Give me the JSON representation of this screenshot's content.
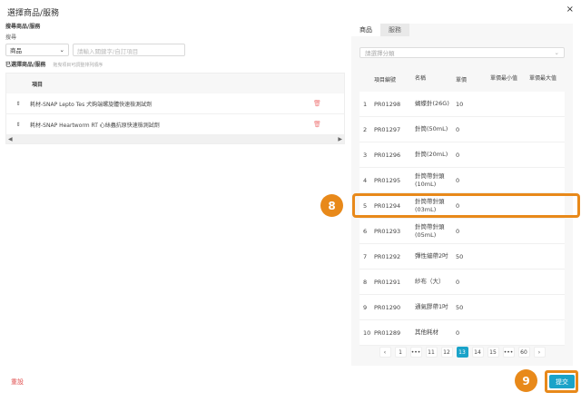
{
  "modal": {
    "title": "選擇商品/服務",
    "close": "×"
  },
  "left": {
    "search_label": "搜尋商品/服務",
    "search_sub": "搜尋",
    "type_select": "商品",
    "search_placeholder": "請輸入關鍵字/自訂項目",
    "selected_label": "已選擇商品/服務",
    "selected_hint": "拖曳項目可調整排列順序",
    "table_header": "項目",
    "items": [
      {
        "handle": "⇕",
        "name": "耗材-SNAP Lepto Tes 犬鉤端螺旋體快速檢測試劑",
        "trash": "🗑"
      },
      {
        "handle": "⇕",
        "name": "耗材-SNAP Heartworm RT 心絲蟲抗原快速檢測試劑",
        "trash": "🗑"
      }
    ],
    "scroll_left": "◀",
    "scroll_right": "▶",
    "reset": "重設"
  },
  "right": {
    "tabs": [
      "商品",
      "服務"
    ],
    "category_placeholder": "請選擇分類",
    "headers": [
      "",
      "項目編號",
      "名稱",
      "單價",
      "單價最小值",
      "單價最大值"
    ],
    "rows": [
      {
        "idx": "1",
        "code": "PR01298",
        "name": "蝴蝶針(26G)",
        "price": "10",
        "min": "",
        "max": ""
      },
      {
        "idx": "2",
        "code": "PR01297",
        "name": "針筒(50mL)",
        "price": "0",
        "min": "",
        "max": ""
      },
      {
        "idx": "3",
        "code": "PR01296",
        "name": "針筒(20mL)",
        "price": "0",
        "min": "",
        "max": ""
      },
      {
        "idx": "4",
        "code": "PR01295",
        "name": "針筒帶針頭 (10mL)",
        "price": "0",
        "min": "",
        "max": ""
      },
      {
        "idx": "5",
        "code": "PR01294",
        "name": "針筒帶針頭 (03mL)",
        "price": "0",
        "min": "",
        "max": ""
      },
      {
        "idx": "6",
        "code": "PR01293",
        "name": "針筒帶針頭 (05mL)",
        "price": "0",
        "min": "",
        "max": ""
      },
      {
        "idx": "7",
        "code": "PR01292",
        "name": "彈性繃帶2吋",
        "price": "50",
        "min": "",
        "max": ""
      },
      {
        "idx": "8",
        "code": "PR01291",
        "name": "紗布（大）",
        "price": "0",
        "min": "",
        "max": ""
      },
      {
        "idx": "9",
        "code": "PR01290",
        "name": "通氣膠帶1吋",
        "price": "50",
        "min": "",
        "max": ""
      },
      {
        "idx": "10",
        "code": "PR01289",
        "name": "其他耗材",
        "price": "0",
        "min": "",
        "max": ""
      }
    ],
    "pager": [
      "‹",
      "1",
      "•••",
      "11",
      "12",
      "13",
      "14",
      "15",
      "•••",
      "60",
      "›"
    ],
    "pager_active": "13"
  },
  "callouts": {
    "row": "8",
    "submit": "9"
  },
  "submit_label": "提交",
  "colors": {
    "accent": "#1aa3c9",
    "callout": "#e8891a",
    "danger": "#e05050"
  }
}
